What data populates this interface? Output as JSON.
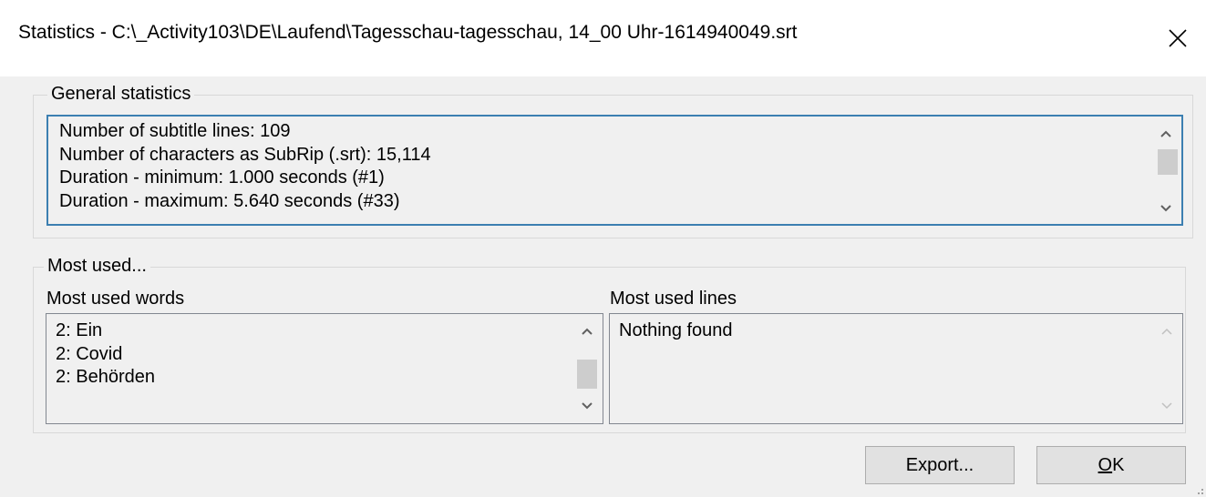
{
  "window": {
    "title": "Statistics - C:\\_Activity103\\DE\\Laufend\\Tagesschau-tagesschau, 14_00 Uhr-1614940049.srt"
  },
  "general": {
    "legend": "General statistics",
    "lines": [
      "Number of subtitle lines: 109",
      "Number of characters as SubRip (.srt): 15,114",
      "Duration - minimum: 1.000 seconds (#1)",
      "Duration - maximum: 5.640 seconds (#33)"
    ]
  },
  "most_used": {
    "legend": "Most used...",
    "words_label": "Most used words",
    "words": [
      "2: Ein",
      "2: Covid",
      "2: Behörden"
    ],
    "lines_label": "Most used lines",
    "lines": [
      "Nothing found"
    ]
  },
  "buttons": {
    "export_label": "Export...",
    "ok_mnemonic": "O",
    "ok_rest": "K"
  },
  "colors": {
    "focus_border": "#3c7fb1",
    "list_border": "#828790",
    "disabled_arrow": "#c0c0c0"
  }
}
